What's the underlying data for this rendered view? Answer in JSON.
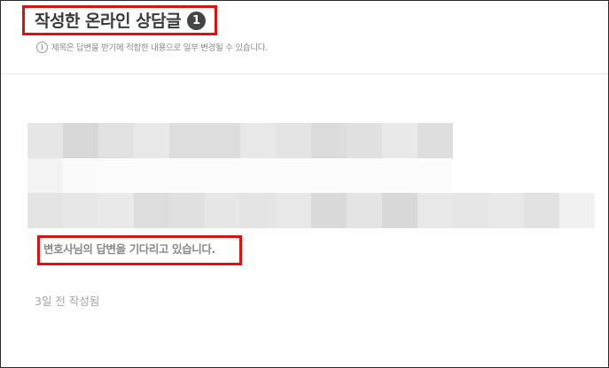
{
  "header": {
    "title": "작성한 온라인 상담글",
    "count_badge": "1",
    "notice": "제목은 답변을 받기에 적합한 내용으로 일부 변경될 수 있습니다."
  },
  "post": {
    "status": "변호사님의 답변을 기다리고 있습니다.",
    "timestamp": "3일 전 작성됨"
  },
  "colors": {
    "highlight_border": "#e01010",
    "title_text": "#3a3a3a",
    "muted_text": "#8a8a8a",
    "badge_bg": "#444444"
  }
}
